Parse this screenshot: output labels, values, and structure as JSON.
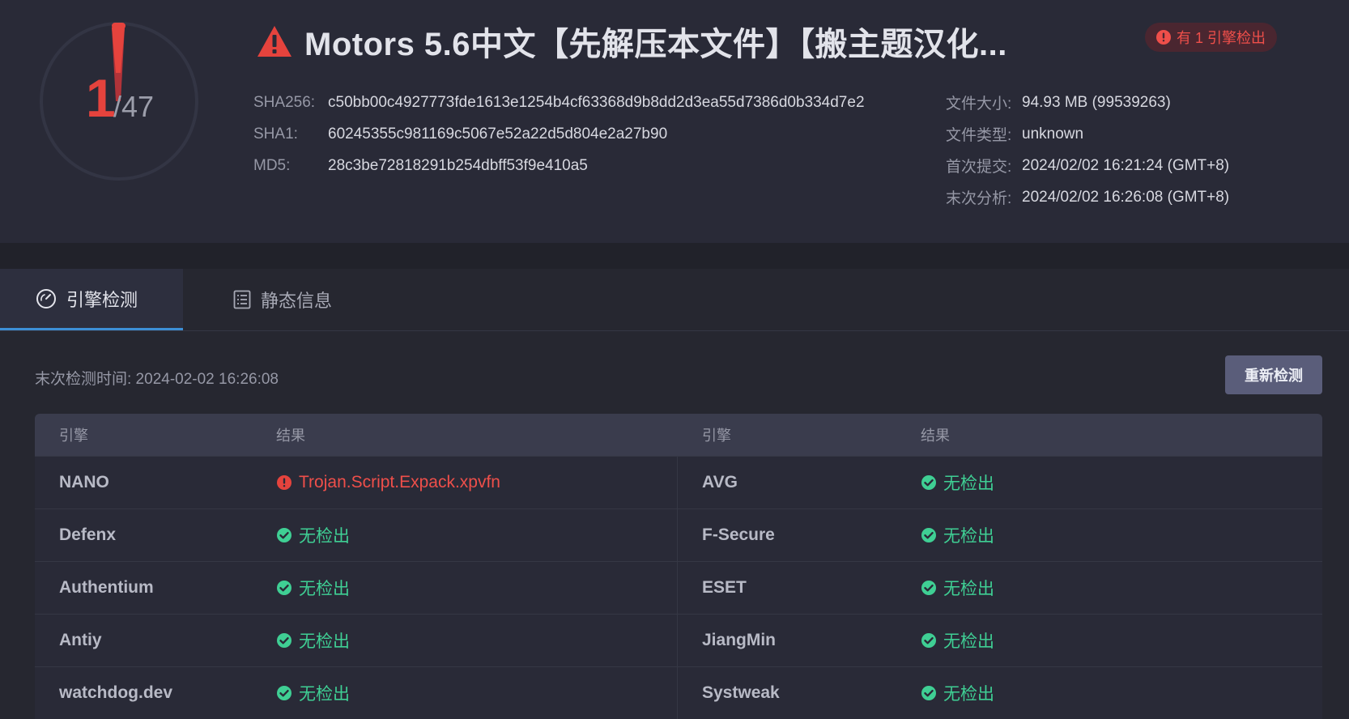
{
  "score": {
    "detected": "1",
    "total": "/47",
    "detected_fraction": 0.0213
  },
  "title": "Motors 5.6中文【先解压本文件】【搬主题汉化...",
  "badge": "有 1 引擎检出",
  "hashes": [
    {
      "label": "SHA256:",
      "value": "c50bb00c4927773fde1613e1254b4cf63368d9b8dd2d3ea55d7386d0b334d7e2"
    },
    {
      "label": "SHA1:",
      "value": "60245355c981169c5067e52a22d5d804e2a27b90"
    },
    {
      "label": "MD5:",
      "value": "28c3be72818291b254dbff53f9e410a5"
    }
  ],
  "meta": [
    {
      "label": "文件大小:",
      "value": "94.93 MB (99539263)"
    },
    {
      "label": "文件类型:",
      "value": "unknown"
    },
    {
      "label": "首次提交:",
      "value": "2024/02/02 16:21:24 (GMT+8)"
    },
    {
      "label": "末次分析:",
      "value": "2024/02/02 16:26:08 (GMT+8)"
    }
  ],
  "tabs": {
    "engine": "引擎检测",
    "static": "静态信息"
  },
  "last_scan": "末次检测时间: 2024-02-02 16:26:08",
  "rescan_label": "重新检测",
  "table": {
    "headers": {
      "engine": "引擎",
      "result": "结果"
    },
    "rows": [
      {
        "left": {
          "engine": "NANO",
          "result": "Trojan.Script.Expack.xpvfn",
          "status": "malicious"
        },
        "right": {
          "engine": "AVG",
          "result": "无检出",
          "status": "clean"
        }
      },
      {
        "left": {
          "engine": "Defenx",
          "result": "无检出",
          "status": "clean"
        },
        "right": {
          "engine": "F-Secure",
          "result": "无检出",
          "status": "clean"
        }
      },
      {
        "left": {
          "engine": "Authentium",
          "result": "无检出",
          "status": "clean"
        },
        "right": {
          "engine": "ESET",
          "result": "无检出",
          "status": "clean"
        }
      },
      {
        "left": {
          "engine": "Antiy",
          "result": "无检出",
          "status": "clean"
        },
        "right": {
          "engine": "JiangMin",
          "result": "无检出",
          "status": "clean"
        }
      },
      {
        "left": {
          "engine": "watchdog.dev",
          "result": "无检出",
          "status": "clean"
        },
        "right": {
          "engine": "Systweak",
          "result": "无检出",
          "status": "clean"
        }
      }
    ]
  },
  "colors": {
    "danger": "#e5433d",
    "clean": "#3fcf94",
    "accent": "#3d8fd6",
    "button": "#5a5d7a"
  },
  "icons": {
    "title": "warning-triangle-icon",
    "badge": "exclamation-circle-icon",
    "tab_engine": "gauge-icon",
    "tab_static": "document-list-icon",
    "clean": "check-circle-icon",
    "malicious": "exclamation-circle-icon"
  }
}
